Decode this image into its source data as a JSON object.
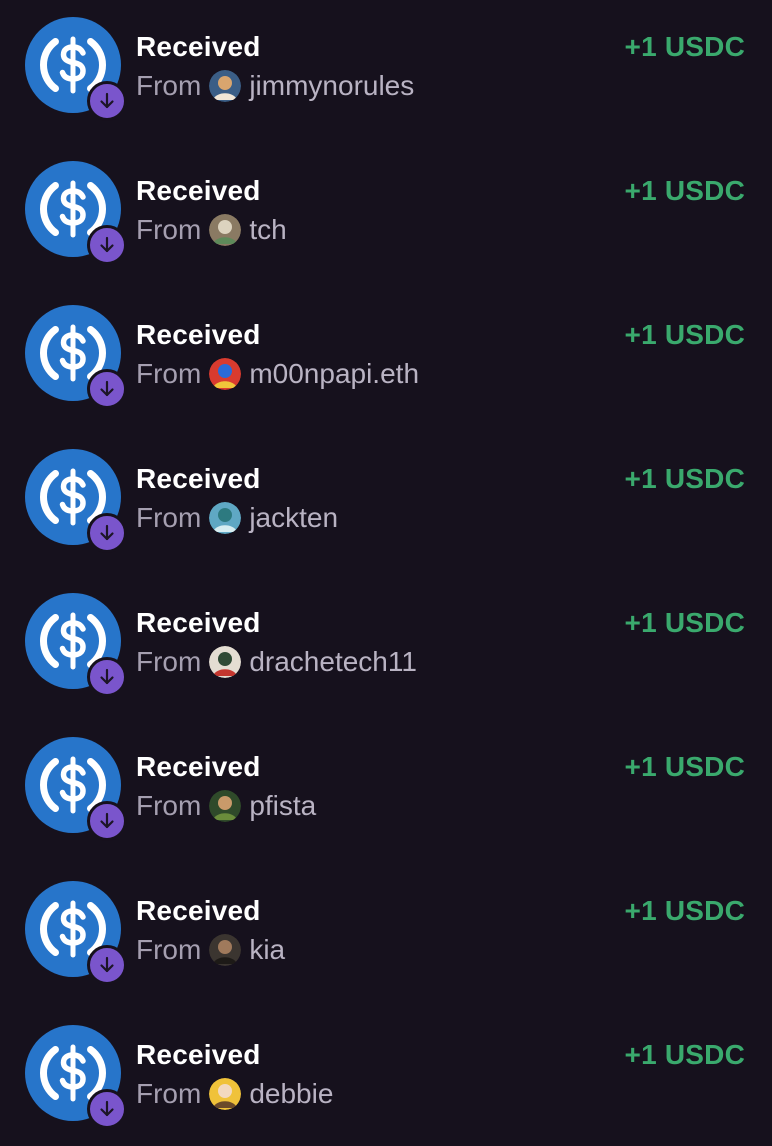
{
  "colors": {
    "background": "#16111d",
    "usdc_blue": "#2775ca",
    "badge_purple": "#7a55cc",
    "amount_green": "#3aa96d",
    "secondary_text": "#a59fb0"
  },
  "transactions": [
    {
      "title": "Received",
      "from_label": "From",
      "username": "jimmynorules",
      "amount": "+1 USDC",
      "token_icon": "usdc-icon",
      "avatar": {
        "bg": "#3b5e86",
        "fg": "#d9a56e",
        "accent": "#f1e6d6"
      }
    },
    {
      "title": "Received",
      "from_label": "From",
      "username": "tch",
      "amount": "+1 USDC",
      "token_icon": "usdc-icon",
      "avatar": {
        "bg": "#8a7a63",
        "fg": "#dcd3bf",
        "accent": "#5e8a5a"
      }
    },
    {
      "title": "Received",
      "from_label": "From",
      "username": "m00npapi.eth",
      "amount": "+1 USDC",
      "token_icon": "usdc-icon",
      "avatar": {
        "bg": "#d93b2f",
        "fg": "#2a6bd8",
        "accent": "#f0c63a"
      }
    },
    {
      "title": "Received",
      "from_label": "From",
      "username": "jackten",
      "amount": "+1 USDC",
      "token_icon": "usdc-icon",
      "avatar": {
        "bg": "#5fa8c4",
        "fg": "#2d7a80",
        "accent": "#d7eef2"
      }
    },
    {
      "title": "Received",
      "from_label": "From",
      "username": "drachetech11",
      "amount": "+1 USDC",
      "token_icon": "usdc-icon",
      "avatar": {
        "bg": "#e4ddd2",
        "fg": "#2f4a35",
        "accent": "#c4372f"
      }
    },
    {
      "title": "Received",
      "from_label": "From",
      "username": "pfista",
      "amount": "+1 USDC",
      "token_icon": "usdc-icon",
      "avatar": {
        "bg": "#2f4a2a",
        "fg": "#c99a6a",
        "accent": "#6a8c3b"
      }
    },
    {
      "title": "Received",
      "from_label": "From",
      "username": "kia",
      "amount": "+1 USDC",
      "token_icon": "usdc-icon",
      "avatar": {
        "bg": "#3b3530",
        "fg": "#a07a5c",
        "accent": "#1d1a17"
      }
    },
    {
      "title": "Received",
      "from_label": "From",
      "username": "debbie",
      "amount": "+1 USDC",
      "token_icon": "usdc-icon",
      "avatar": {
        "bg": "#f0c23a",
        "fg": "#f3d9c0",
        "accent": "#6b4a2a"
      }
    }
  ]
}
